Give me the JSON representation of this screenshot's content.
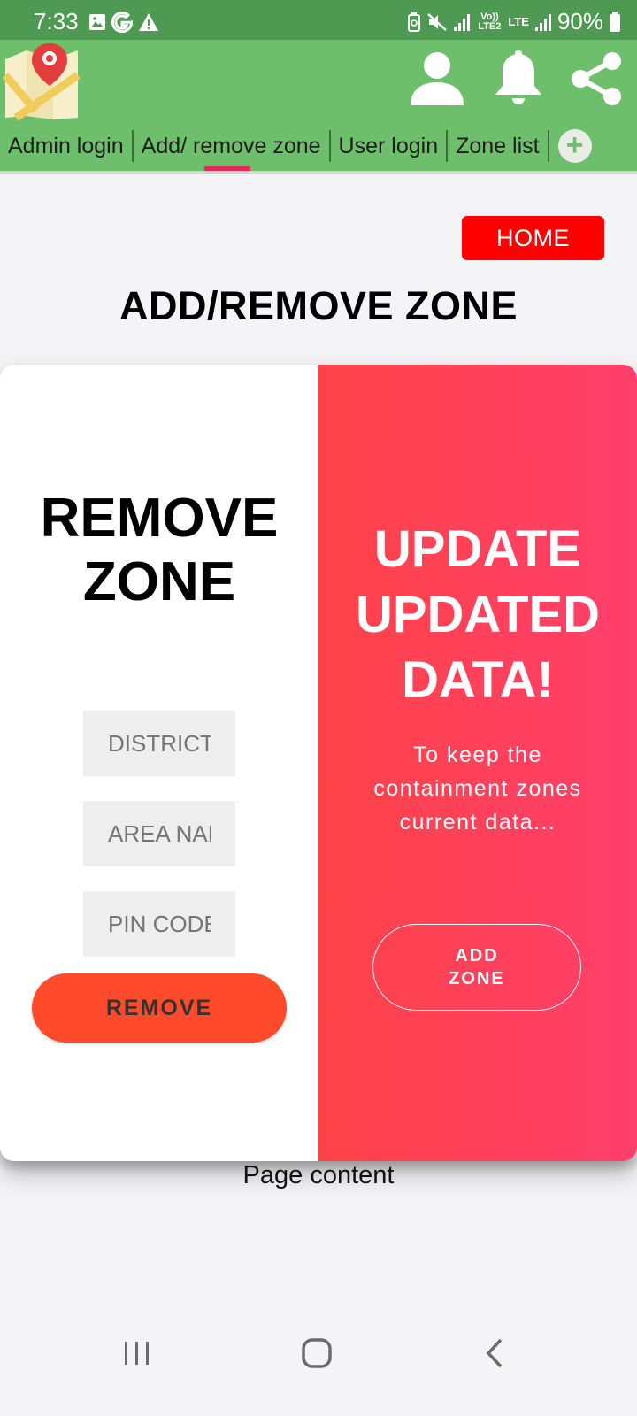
{
  "status_bar": {
    "time": "7:33",
    "left_icons": [
      "image-icon",
      "google-g-icon",
      "warning-icon"
    ],
    "lte_small": "Vo)) LTE2",
    "lte_label": "LTE",
    "battery": "90%"
  },
  "header": {
    "logo": "map-pin-logo",
    "icons": [
      "user-icon",
      "bell-icon",
      "share-icon"
    ],
    "tabs": [
      {
        "label": "Admin login"
      },
      {
        "label": "Add/ remove zone"
      },
      {
        "label": "User login"
      },
      {
        "label": "Zone list"
      }
    ],
    "active_tab": 1,
    "add_tab_symbol": "+"
  },
  "page": {
    "home_button": "HOME",
    "title": "ADD/REMOVE ZONE",
    "footer_text": "Page content"
  },
  "remove_panel": {
    "title_line1": "REMOVE",
    "title_line2": "ZONE",
    "fields": [
      {
        "placeholder": "DISTRICT NAME"
      },
      {
        "placeholder": "AREA NAME"
      },
      {
        "placeholder": "PIN CODE"
      }
    ],
    "button": "REMOVE"
  },
  "update_panel": {
    "title_line1": "UPDATE",
    "title_line2": "UPDATED",
    "title_line3": "DATA!",
    "description": "To keep the containment zones current data...",
    "button_line1": "ADD",
    "button_line2": "ZONE"
  },
  "nav_bar": {
    "items": [
      "recents-icon",
      "home-icon",
      "back-icon"
    ]
  },
  "colors": {
    "status_bar": "#4e9a52",
    "app_bar": "#6ebf6b",
    "active_tab_indicator": "#e9255e",
    "home_button": "#ff0000",
    "remove_button": "#ff4a2b",
    "update_gradient_start": "#ff4348",
    "update_gradient_end": "#ff3f6c"
  }
}
